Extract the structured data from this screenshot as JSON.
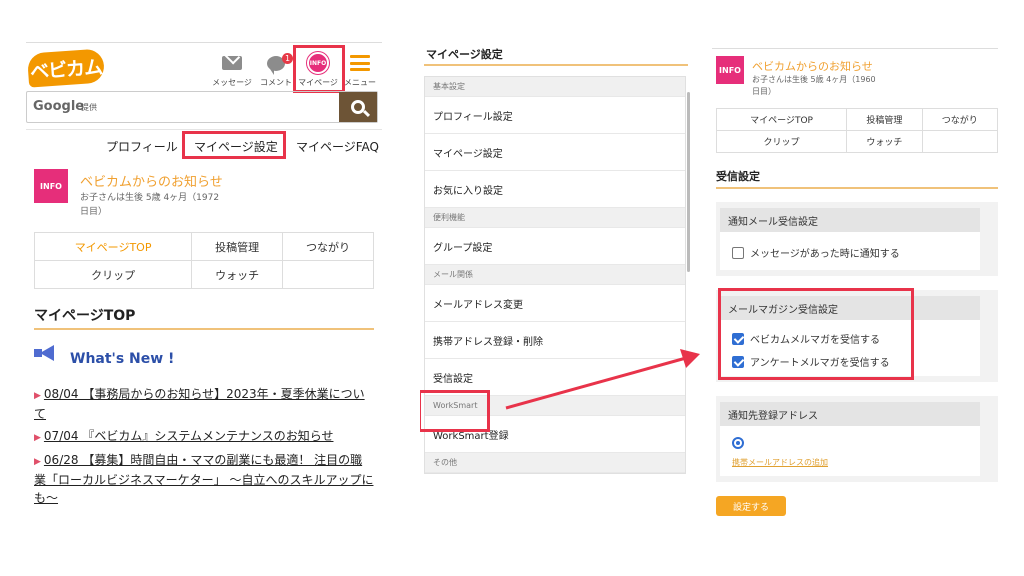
{
  "header": {
    "logo_text": "ベビカム",
    "icons": [
      {
        "name": "message",
        "label": "メッセージ"
      },
      {
        "name": "comment",
        "label": "コメント",
        "badge": "1"
      },
      {
        "name": "mypage",
        "label": "マイページ",
        "icon_text": "INFO"
      },
      {
        "name": "menu",
        "label": "メニュー"
      }
    ]
  },
  "search": {
    "logo": "Google",
    "provided": "提供"
  },
  "tabs": [
    "プロフィール",
    "マイページ設定",
    "マイページFAQ"
  ],
  "notice": {
    "logo_text": "INFO",
    "title": "ベビカムからのお知らせ",
    "sub_line1": "お子さんは生後 5歳 4ヶ月（1972",
    "sub_line2": "日目）",
    "sub_line1_r": "お子さんは生後 5歳 4ヶ月（1960",
    "sub_line2_r": "日目）"
  },
  "grid": [
    [
      "マイページTOP",
      "投稿管理",
      "つながり"
    ],
    [
      "クリップ",
      "ウォッチ",
      ""
    ]
  ],
  "mypage_top": {
    "title": "マイページTOP",
    "whats_new": "What's New !"
  },
  "news": [
    "08/04 【事務局からのお知らせ】2023年・夏季休業について",
    "07/04 『ベビカム』システムメンテナンスのお知らせ",
    "06/28 【募集】時間自由・ママの副業にも最適！ 注目の職業「ローカルビジネスマーケター」 〜自立へのスキルアップにも〜"
  ],
  "settings_menu": {
    "title": "マイページ設定",
    "rows": [
      {
        "type": "hdr",
        "label": "基本設定"
      },
      {
        "type": "item",
        "label": "プロフィール設定"
      },
      {
        "type": "item",
        "label": "マイページ設定"
      },
      {
        "type": "item",
        "label": "お気に入り設定"
      },
      {
        "type": "hdr",
        "label": "便利機能"
      },
      {
        "type": "item",
        "label": "グループ設定"
      },
      {
        "type": "hdr",
        "label": "メール関係"
      },
      {
        "type": "item",
        "label": "メールアドレス変更"
      },
      {
        "type": "item",
        "label": "携帯アドレス登録・削除"
      },
      {
        "type": "item",
        "label": "受信設定"
      },
      {
        "type": "hdr",
        "label": "WorkSmart"
      },
      {
        "type": "item",
        "label": "WorkSmart登録"
      },
      {
        "type": "hdr",
        "label": "その他"
      }
    ]
  },
  "receive": {
    "title": "受信設定",
    "notify_header": "通知メール受信設定",
    "notify_option": "メッセージがあった時に通知する",
    "magazine_header": "メールマガジン受信設定",
    "magazine_options": [
      "ベビカムメルマガを受信する",
      "アンケートメルマガを受信する"
    ],
    "address_header": "通知先登録アドレス",
    "address_link": "携帯メールアドレスの追加",
    "submit": "設定する"
  },
  "colors": {
    "accent": "#f39800",
    "highlight": "#e8334a",
    "info": "#e62e7a",
    "link_blue": "#2c4fa8"
  }
}
